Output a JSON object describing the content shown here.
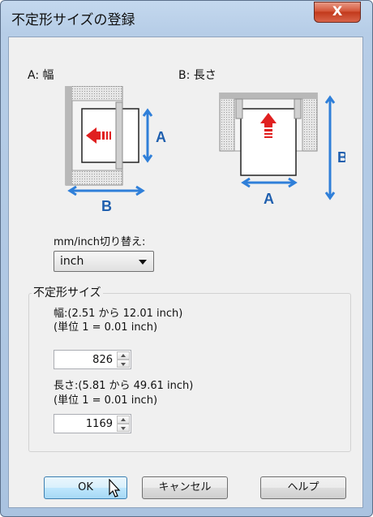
{
  "window": {
    "title": "不定形サイズの登録",
    "close_label": "X"
  },
  "diagram": {
    "caption_a": "A: 幅",
    "caption_b": "B: 長さ",
    "a_letter": "A",
    "b_letter": "B"
  },
  "unit": {
    "label": "mm/inch切り替え:",
    "selected": "inch"
  },
  "custom_size": {
    "legend": "不定形サイズ",
    "width_range": "幅:(2.51 から 12.01 inch)",
    "width_unit": "(単位 1 = 0.01 inch)",
    "width_value": "826",
    "length_range": "長さ:(5.81 から 49.61 inch)",
    "length_unit": "(単位 1 = 0.01 inch)",
    "length_value": "1169"
  },
  "buttons": {
    "ok": "OK",
    "cancel": "キャンセル",
    "help": "ヘルプ"
  },
  "colors": {
    "accent_blue": "#2f7fd9",
    "arrow_red": "#e02020",
    "close_red": "#c23a1c"
  }
}
